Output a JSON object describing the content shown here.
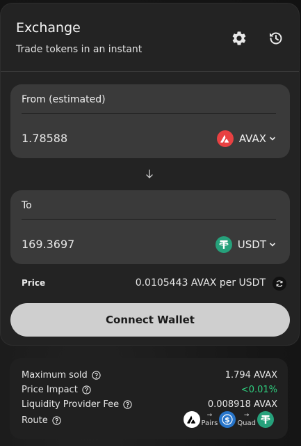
{
  "header": {
    "title": "Exchange",
    "subtitle": "Trade tokens in an instant"
  },
  "from": {
    "label": "From (estimated)",
    "amount": "1.78588",
    "token": "AVAX",
    "token_color": "#e84142"
  },
  "to": {
    "label": "To",
    "amount": "169.3697",
    "token": "USDT",
    "token_color": "#26a17b"
  },
  "price": {
    "label": "Price",
    "value": "0.0105443 AVAX per USDT"
  },
  "connect_button": "Connect Wallet",
  "details": {
    "max_sold_label": "Maximum sold",
    "max_sold_value": "1.794 AVAX",
    "price_impact_label": "Price Impact",
    "price_impact_value": "<0.01%",
    "lp_fee_label": "Liquidity Provider Fee",
    "lp_fee_value": "0.008918 AVAX",
    "route_label": "Route",
    "route_hop1": "Pairs",
    "route_hop2": "Quad",
    "route_colors": [
      "#ffffff",
      "#2775ca",
      "#26a17b"
    ]
  },
  "colors": {
    "accent_green": "#2fcf7f",
    "button_bg": "#cfcfcf"
  }
}
